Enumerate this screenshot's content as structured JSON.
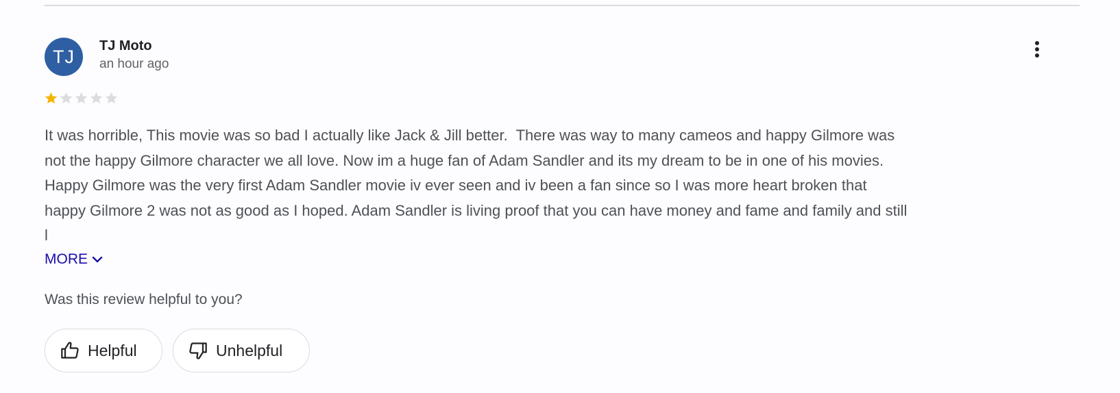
{
  "review": {
    "avatar_initials": "TJ",
    "avatar_color": "#2f5fa3",
    "reviewer_name": "TJ Moto",
    "time_ago": "an hour ago",
    "rating": 1,
    "rating_max": 5,
    "star_filled_color": "#f5b400",
    "star_empty_color": "#dadce0",
    "text": "It was horrible, This movie was so bad I actually like Jack & Jill better.  There was way to many cameos and happy Gilmore was\nnot the happy Gilmore character we all love. Now im a huge fan of Adam Sandler and its my dream to be in one of his movies.\nHappy Gilmore was the very first Adam Sandler movie iv ever seen and iv been a fan since so I was more heart broken that\nhappy Gilmore 2 was not as good as I hoped. Adam Sandler is living proof that you can have money and fame and family and still\nl",
    "more_label": "MORE",
    "helpful_question": "Was this review helpful to you?",
    "helpful_label": "Helpful",
    "unhelpful_label": "Unhelpful"
  },
  "icons": {
    "more_options": "more-vert-icon",
    "expand": "chevron-down-icon",
    "helpful": "thumb-up-icon",
    "unhelpful": "thumb-down-icon"
  },
  "colors": {
    "link": "#1a0dab",
    "divider": "#dadce0"
  }
}
